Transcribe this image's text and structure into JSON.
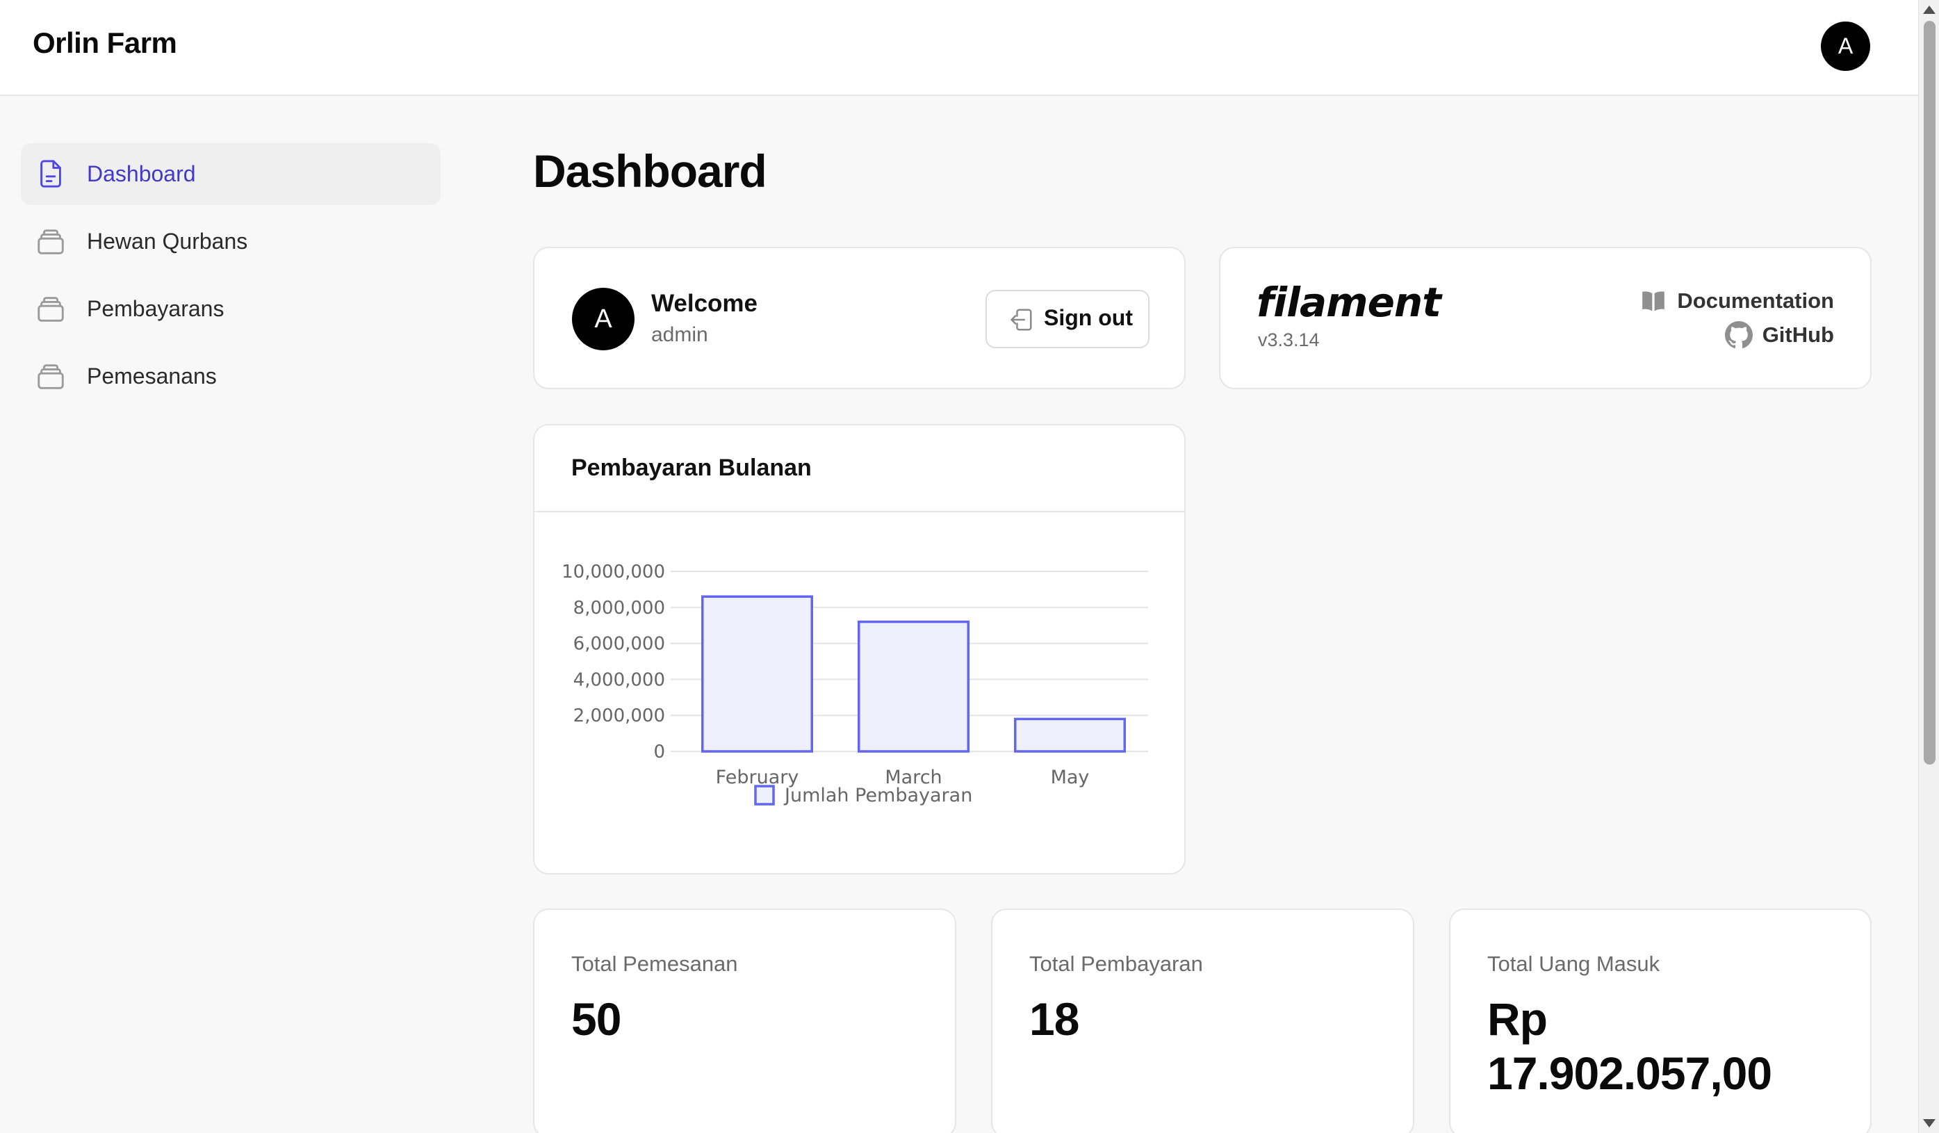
{
  "app": {
    "brand": "Orlin Farm",
    "user_initial": "A"
  },
  "sidebar": {
    "items": [
      {
        "label": "Dashboard",
        "icon": "document-icon",
        "active": true
      },
      {
        "label": "Hewan Qurbans",
        "icon": "stack-icon",
        "active": false
      },
      {
        "label": "Pembayarans",
        "icon": "stack-icon",
        "active": false
      },
      {
        "label": "Pemesanans",
        "icon": "stack-icon",
        "active": false
      }
    ]
  },
  "page": {
    "title": "Dashboard"
  },
  "welcome": {
    "avatar_initial": "A",
    "title": "Welcome",
    "username": "admin",
    "signout_label": "Sign out"
  },
  "filament": {
    "logo": "filament",
    "version": "v3.3.14",
    "documentation_label": "Documentation",
    "github_label": "GitHub"
  },
  "chart_widget": {
    "title": "Pembayaran Bulanan"
  },
  "chart_data": {
    "type": "bar",
    "categories": [
      "February",
      "March",
      "May"
    ],
    "series": [
      {
        "name": "Jumlah Pembayaran",
        "values": [
          8600000,
          7200000,
          1800000
        ]
      }
    ],
    "ylim": [
      0,
      10000000
    ],
    "yticks": [
      0,
      2000000,
      4000000,
      6000000,
      8000000,
      10000000
    ],
    "ytick_labels": [
      "0",
      "2,000,000",
      "4,000,000",
      "6,000,000",
      "8,000,000",
      "10,000,000"
    ],
    "grid": true,
    "legend_position": "bottom",
    "colors": {
      "border": "#6366f1",
      "fill": "#eef0fd"
    }
  },
  "stats": [
    {
      "label": "Total Pemesanan",
      "value": "50"
    },
    {
      "label": "Total Pembayaran",
      "value": "18"
    },
    {
      "label": "Total Uang Masuk",
      "value_line1": "Rp",
      "value_line2": "17.902.057,00"
    }
  ],
  "colors": {
    "accent": "#4338ca",
    "primary": "#6366f1"
  }
}
